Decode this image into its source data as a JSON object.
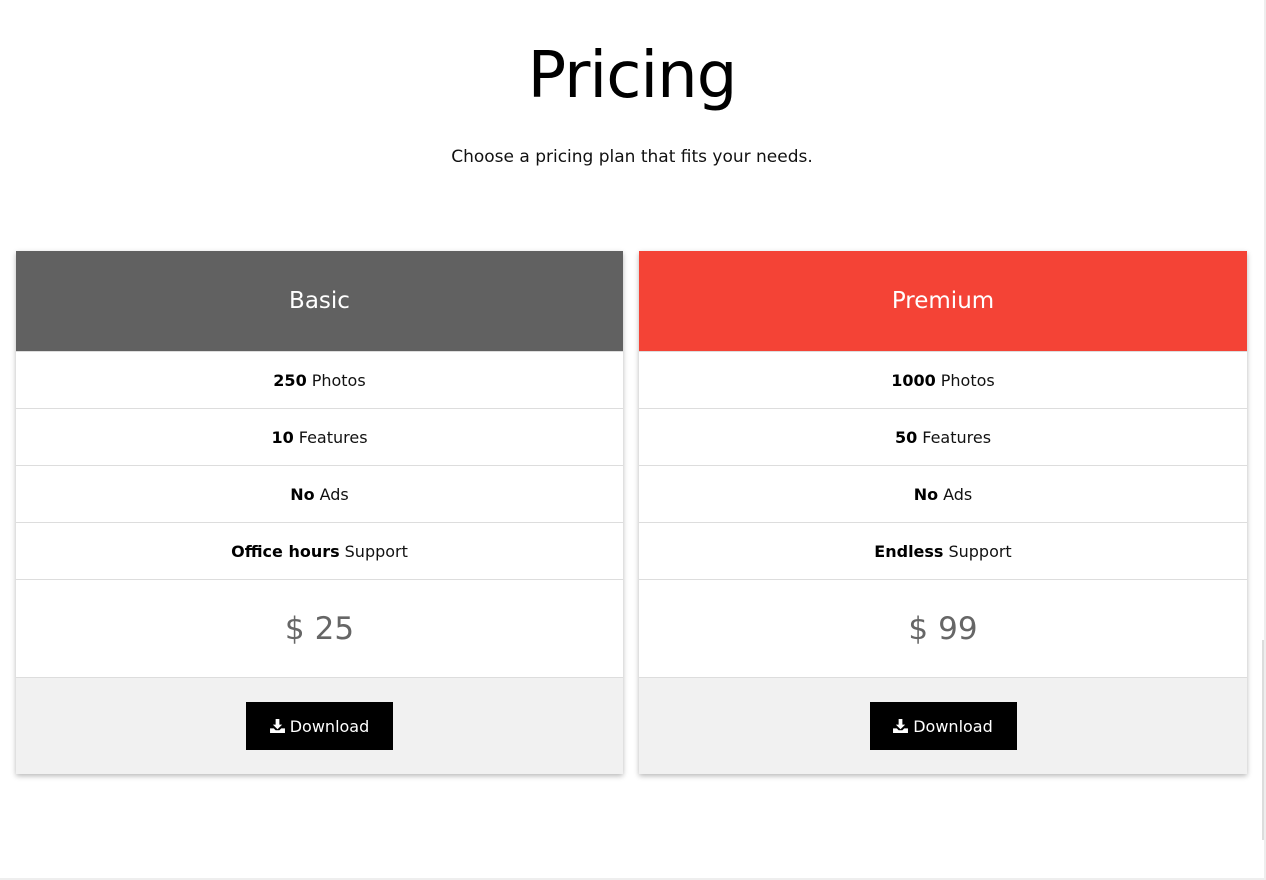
{
  "page": {
    "title": "Pricing",
    "subtitle": "Choose a pricing plan that fits your needs."
  },
  "plans": [
    {
      "name": "Basic",
      "header_color": "#616161",
      "features": [
        {
          "value": "250",
          "label": "Photos"
        },
        {
          "value": "10",
          "label": "Features"
        },
        {
          "value": "No",
          "label": "Ads"
        },
        {
          "value": "Office hours",
          "label": "Support"
        }
      ],
      "currency": "$",
      "price": "25",
      "button_label": "Download",
      "button_icon": "download-icon"
    },
    {
      "name": "Premium",
      "header_color": "#f44336",
      "features": [
        {
          "value": "1000",
          "label": "Photos"
        },
        {
          "value": "50",
          "label": "Features"
        },
        {
          "value": "No",
          "label": "Ads"
        },
        {
          "value": "Endless",
          "label": "Support"
        }
      ],
      "currency": "$",
      "price": "99",
      "button_label": "Download",
      "button_icon": "download-icon"
    }
  ]
}
